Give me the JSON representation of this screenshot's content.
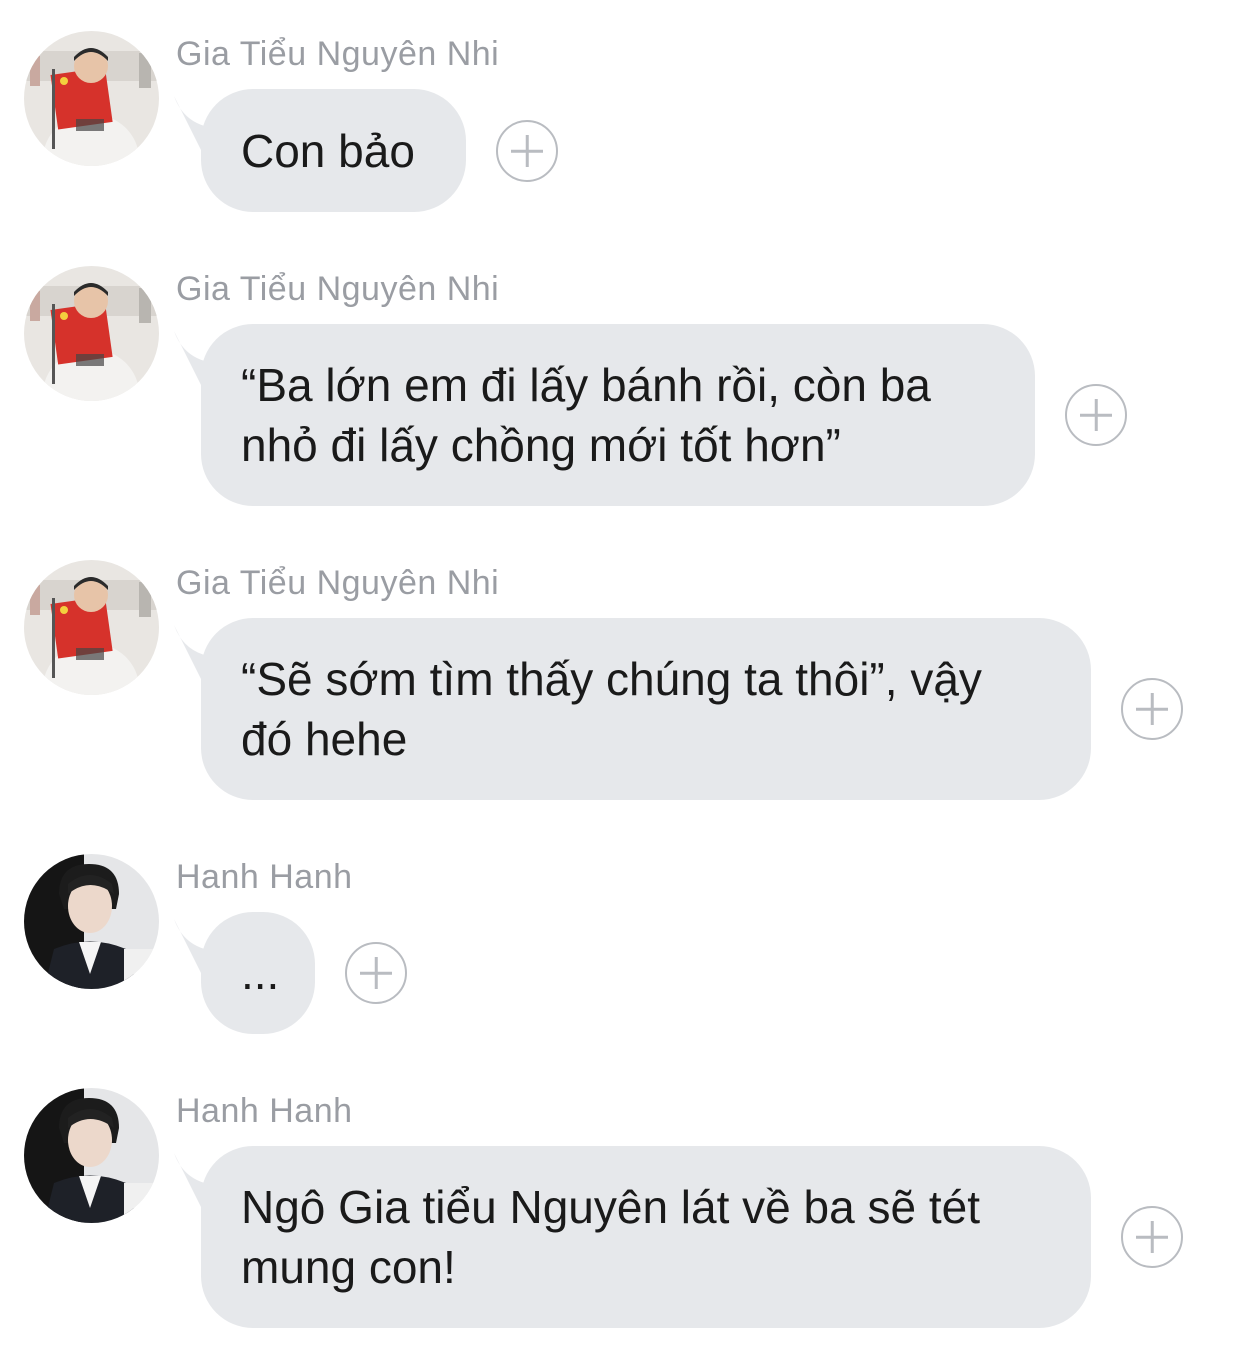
{
  "messages": [
    {
      "sender": "Gia Tiểu Nguyên Nhi",
      "text": "Con bảo"
    },
    {
      "sender": "Gia Tiểu Nguyên Nhi",
      "text": "“Ba lớn em đi lấy bánh rồi, còn ba\nnhỏ đi lấy chồng mới tốt hơn”"
    },
    {
      "sender": "Gia Tiểu Nguyên Nhi",
      "text": "“Sẽ sớm tìm thấy chúng ta thôi”, vậy\nđó hehe"
    },
    {
      "sender": "Hanh Hanh",
      "text": "..."
    },
    {
      "sender": "Hanh Hanh",
      "text": "Ngô Gia tiểu Nguyên lát về ba sẽ tét\nmung con!"
    }
  ],
  "colors": {
    "bubble": "#e6e8eb",
    "sender_name": "#9a9da3",
    "add_icon": "#b9bcc1"
  },
  "icons": {
    "add_reaction": "plus-circle-icon"
  }
}
